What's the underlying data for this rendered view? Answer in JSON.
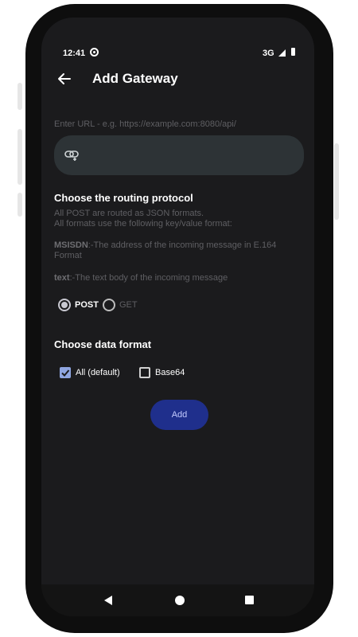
{
  "status_bar": {
    "time": "12:41",
    "network": "3G"
  },
  "app_bar": {
    "title": "Add Gateway"
  },
  "url_field": {
    "hint": "Enter URL - e.g. https://example.com:8080/api/",
    "value": ""
  },
  "routing": {
    "heading": "Choose the routing protocol",
    "line1": "All POST are routed as JSON formats.",
    "line2": "All formats use the following key/value format:",
    "msisdn_key": "MSISDN",
    "msisdn_desc": ":-The address of the incoming message in E.164 Format",
    "text_key": "text",
    "text_desc": ":-The text body of the incoming message",
    "options": [
      {
        "label": "POST",
        "selected": true
      },
      {
        "label": "GET",
        "selected": false
      }
    ]
  },
  "data_format": {
    "heading": "Choose data format",
    "options": [
      {
        "label": "All (default)",
        "checked": true
      },
      {
        "label": "Base64",
        "checked": false
      }
    ]
  },
  "actions": {
    "add_label": "Add"
  },
  "colors": {
    "accent": "#1f2f8c",
    "field_bg": "#2d3336",
    "screen_bg": "#1b1b1d"
  },
  "icons": {
    "back": "arrow-left-icon",
    "link": "link-icon",
    "status": "gear-icon"
  }
}
